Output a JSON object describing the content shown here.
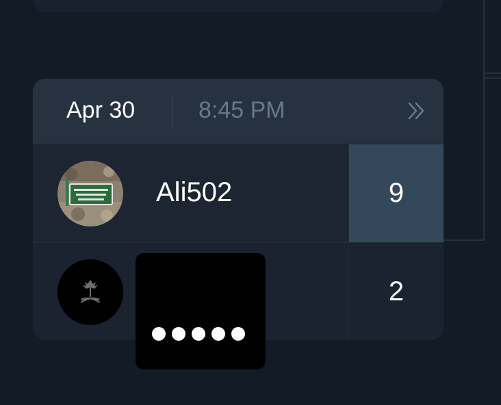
{
  "match": {
    "date": "Apr 30",
    "time": "8:45 PM",
    "expand_icon": "double-chevron-right-icon",
    "players": [
      {
        "name": "Ali502",
        "score": "9",
        "winner": true,
        "avatar": "photo-avatar"
      },
      {
        "name": "",
        "score": "2",
        "winner": false,
        "avatar": "emblem-avatar",
        "name_masked_dots": 5
      }
    ]
  },
  "colors": {
    "background": "#131b26",
    "card": "#1a232f",
    "header": "#26323f",
    "winner_highlight": "#33495b",
    "time_text": "#647a88",
    "text": "#ffffff"
  }
}
